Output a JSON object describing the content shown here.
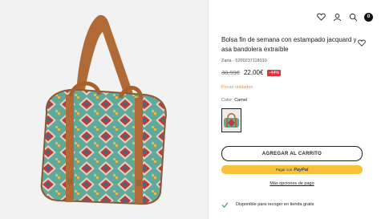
{
  "product": {
    "title": "Bolsa fin de semana con estampado jacquard y asa bandolera extraíble",
    "reference": "Zaria - 5200237118010",
    "old_price": "38,99€",
    "new_price": "22,00€",
    "discount": "-44%",
    "stock_status": "Pocas unidades",
    "color_label": "Color:",
    "color_value": "Camel"
  },
  "actions": {
    "add_to_cart": "AGREGAR AL CARRITO",
    "paypal_prefix": "Pagar con",
    "paypal_brand": "PayPal",
    "more_payment": "Más opciones de pago"
  },
  "pickup": {
    "text": "Disponible para recoger en tienda gratis"
  },
  "header": {
    "cart_count": "0",
    "icons": [
      "heart-icon",
      "user-icon",
      "search-icon",
      "cart-badge"
    ]
  },
  "colors": {
    "stock": "#f08a3c",
    "discount_bg": "#e0313e",
    "paypal_bg": "#f7c23a",
    "check": "#2e9e5b",
    "strap": "#b06a35"
  }
}
